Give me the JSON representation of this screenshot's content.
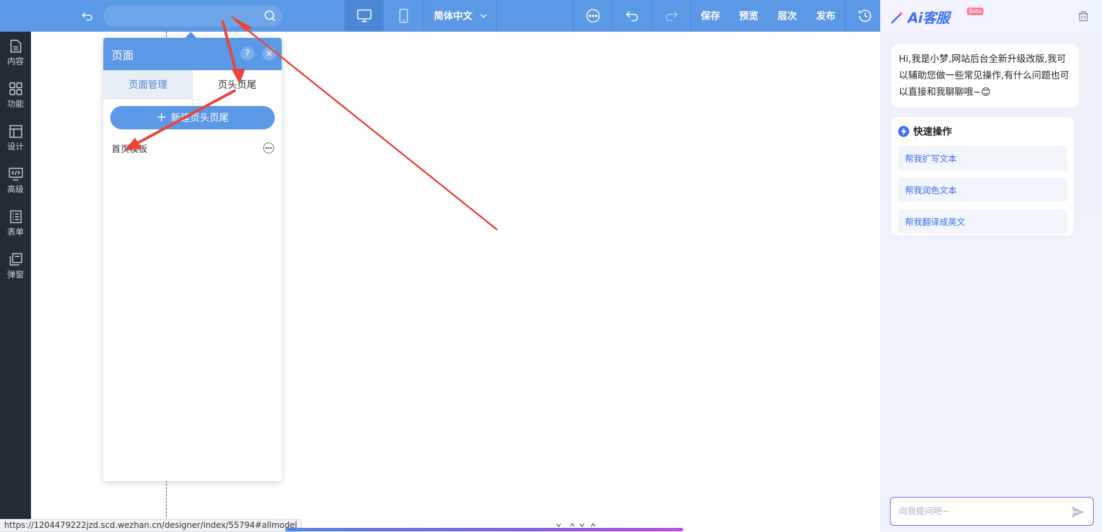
{
  "topbar": {
    "search": {
      "value": "",
      "placeholder": ""
    },
    "devices": [
      "desktop-icon",
      "mobile-icon"
    ],
    "language": "简体中文",
    "actions": {
      "save": "保存",
      "preview": "预览",
      "layers": "层次",
      "publish": "发布"
    },
    "icons": [
      "more-icon",
      "undo-icon",
      "redo-icon",
      "history-icon"
    ]
  },
  "sidebar": {
    "items": [
      {
        "label": "内容",
        "icon": "document-icon"
      },
      {
        "label": "功能",
        "icon": "grid-icon"
      },
      {
        "label": "设计",
        "icon": "layout-icon"
      },
      {
        "label": "高级",
        "icon": "code-icon"
      },
      {
        "label": "表单",
        "icon": "form-icon"
      },
      {
        "label": "弹窗",
        "icon": "popup-icon"
      }
    ]
  },
  "page_panel": {
    "title": "页面",
    "help": "?",
    "close": "×",
    "tabs": [
      "页面管理",
      "页头页尾"
    ],
    "active_tab": 1,
    "add_button": "新建页头页尾",
    "templates": [
      {
        "name": "首页模板"
      }
    ]
  },
  "ai_panel": {
    "logo_text": "Ai客服",
    "beta_label": "Beta",
    "greeting": "Hi,我是小梦,网站后台全新升级改版,我可以辅助您做一些常见操作,有什么问题也可以直接和我聊聊哦~😊",
    "quick_actions": {
      "title": "快速操作",
      "items": [
        "帮我扩写文本",
        "帮我润色文本",
        "帮我翻译成英文"
      ]
    },
    "input": {
      "placeholder": "向我提问吧~",
      "value": ""
    }
  },
  "statusbar": {
    "url": "https://1204479222jzd.scd.wezhan.cn/designer/index/55794#allmodel"
  },
  "colors": {
    "topbar": "#5b98e6",
    "sidebar": "#232b38",
    "accent": "#3d6ff0",
    "arrow": "#e8453c"
  }
}
